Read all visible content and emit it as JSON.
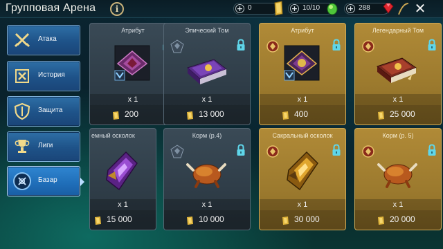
{
  "header": {
    "title": "Групповая Арена",
    "info_icon": "i",
    "resources": [
      {
        "value": "0",
        "icon": "gold-bar-icon"
      },
      {
        "value": "10/10",
        "icon": "green-token-icon"
      },
      {
        "value": "288",
        "icon": "ruby-icon"
      }
    ],
    "close_icon": "close-icon"
  },
  "sidebar": {
    "items": [
      {
        "label": "Атака",
        "icon": "crossed-swords-icon",
        "active": false
      },
      {
        "label": "История",
        "icon": "scroll-icon",
        "active": false
      },
      {
        "label": "Защита",
        "icon": "shield-icon",
        "active": false
      },
      {
        "label": "Лиги",
        "icon": "trophy-icon",
        "active": false
      },
      {
        "label": "Базар",
        "icon": "bazaar-icon",
        "active": true
      }
    ]
  },
  "shop": {
    "items": [
      {
        "name": "Атрибут",
        "qty": "x 1",
        "price": "200",
        "rarity": "gray",
        "art": "gem-icon",
        "locked": true
      },
      {
        "name": "Эпический Том",
        "qty": "x 1",
        "price": "13 000",
        "rarity": "gray",
        "art": "purple-tome-icon",
        "locked": true
      },
      {
        "name": "Атрибут",
        "qty": "x 1",
        "price": "400",
        "rarity": "gold",
        "art": "gem-icon",
        "locked": true
      },
      {
        "name": "Легендарный Том",
        "qty": "x 1",
        "price": "25 000",
        "rarity": "gold",
        "art": "red-tome-icon",
        "locked": true
      },
      {
        "name": "емный осколок",
        "qty": "x 1",
        "price": "15 000",
        "rarity": "gray",
        "art": "purple-shard-icon",
        "locked": false
      },
      {
        "name": "Корм (р.4)",
        "qty": "x 1",
        "price": "10 000",
        "rarity": "gray",
        "art": "roast-chicken-icon",
        "locked": true
      },
      {
        "name": "Сакральный осколок",
        "qty": "x 1",
        "price": "30 000",
        "rarity": "gold",
        "art": "gold-shard-icon",
        "locked": true
      },
      {
        "name": "Корм (р. 5)",
        "qty": "x 1",
        "price": "20 000",
        "rarity": "gold",
        "art": "roast-chicken-icon",
        "locked": true
      }
    ]
  },
  "colors": {
    "tab_blue": "#1e5288",
    "card_gray": "#2f3d48",
    "card_gold": "#9c7a2e",
    "lock_cyan": "#5fd6ea"
  }
}
